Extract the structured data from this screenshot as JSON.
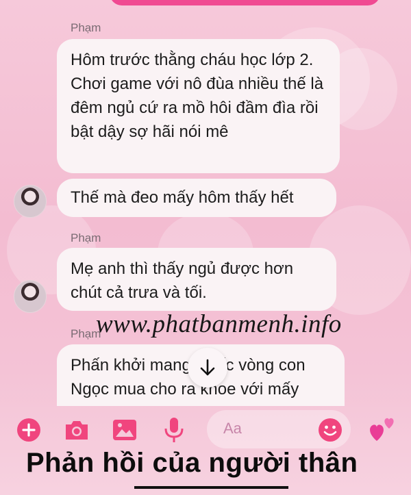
{
  "messages": [
    {
      "sender": "Phạm",
      "text": "Hôm trước thằng cháu học lớp 2. Chơi game với nô đùa nhiều thế là đêm ngủ cứ ra mồ hôi đầm đìa rồi bật dậy sợ hãi nói mê"
    },
    {
      "text": "Thế mà đeo mấy hôm thấy hết"
    },
    {
      "sender": "Phạm",
      "text": "Mẹ anh thì thấy ngủ được hơn chút cả trưa và tối."
    },
    {
      "sender": "Phạm",
      "text": "Phấn khởi mang chiếc vòng con Ngọc mua cho ra khoe với mấy"
    }
  ],
  "composer": {
    "placeholder": "Aa"
  },
  "watermark": "www.phatbanmenh.info",
  "caption": "Phản hồi của người thân",
  "icons": {
    "add": "plus-circle-icon",
    "camera": "camera-icon",
    "image": "image-icon",
    "mic": "microphone-icon",
    "emoji": "smiley-icon",
    "hearts": "two-hearts-icon",
    "scroll": "arrow-down-icon"
  },
  "colors": {
    "accent": "#f04a92",
    "bubble": "#faf3f5"
  }
}
